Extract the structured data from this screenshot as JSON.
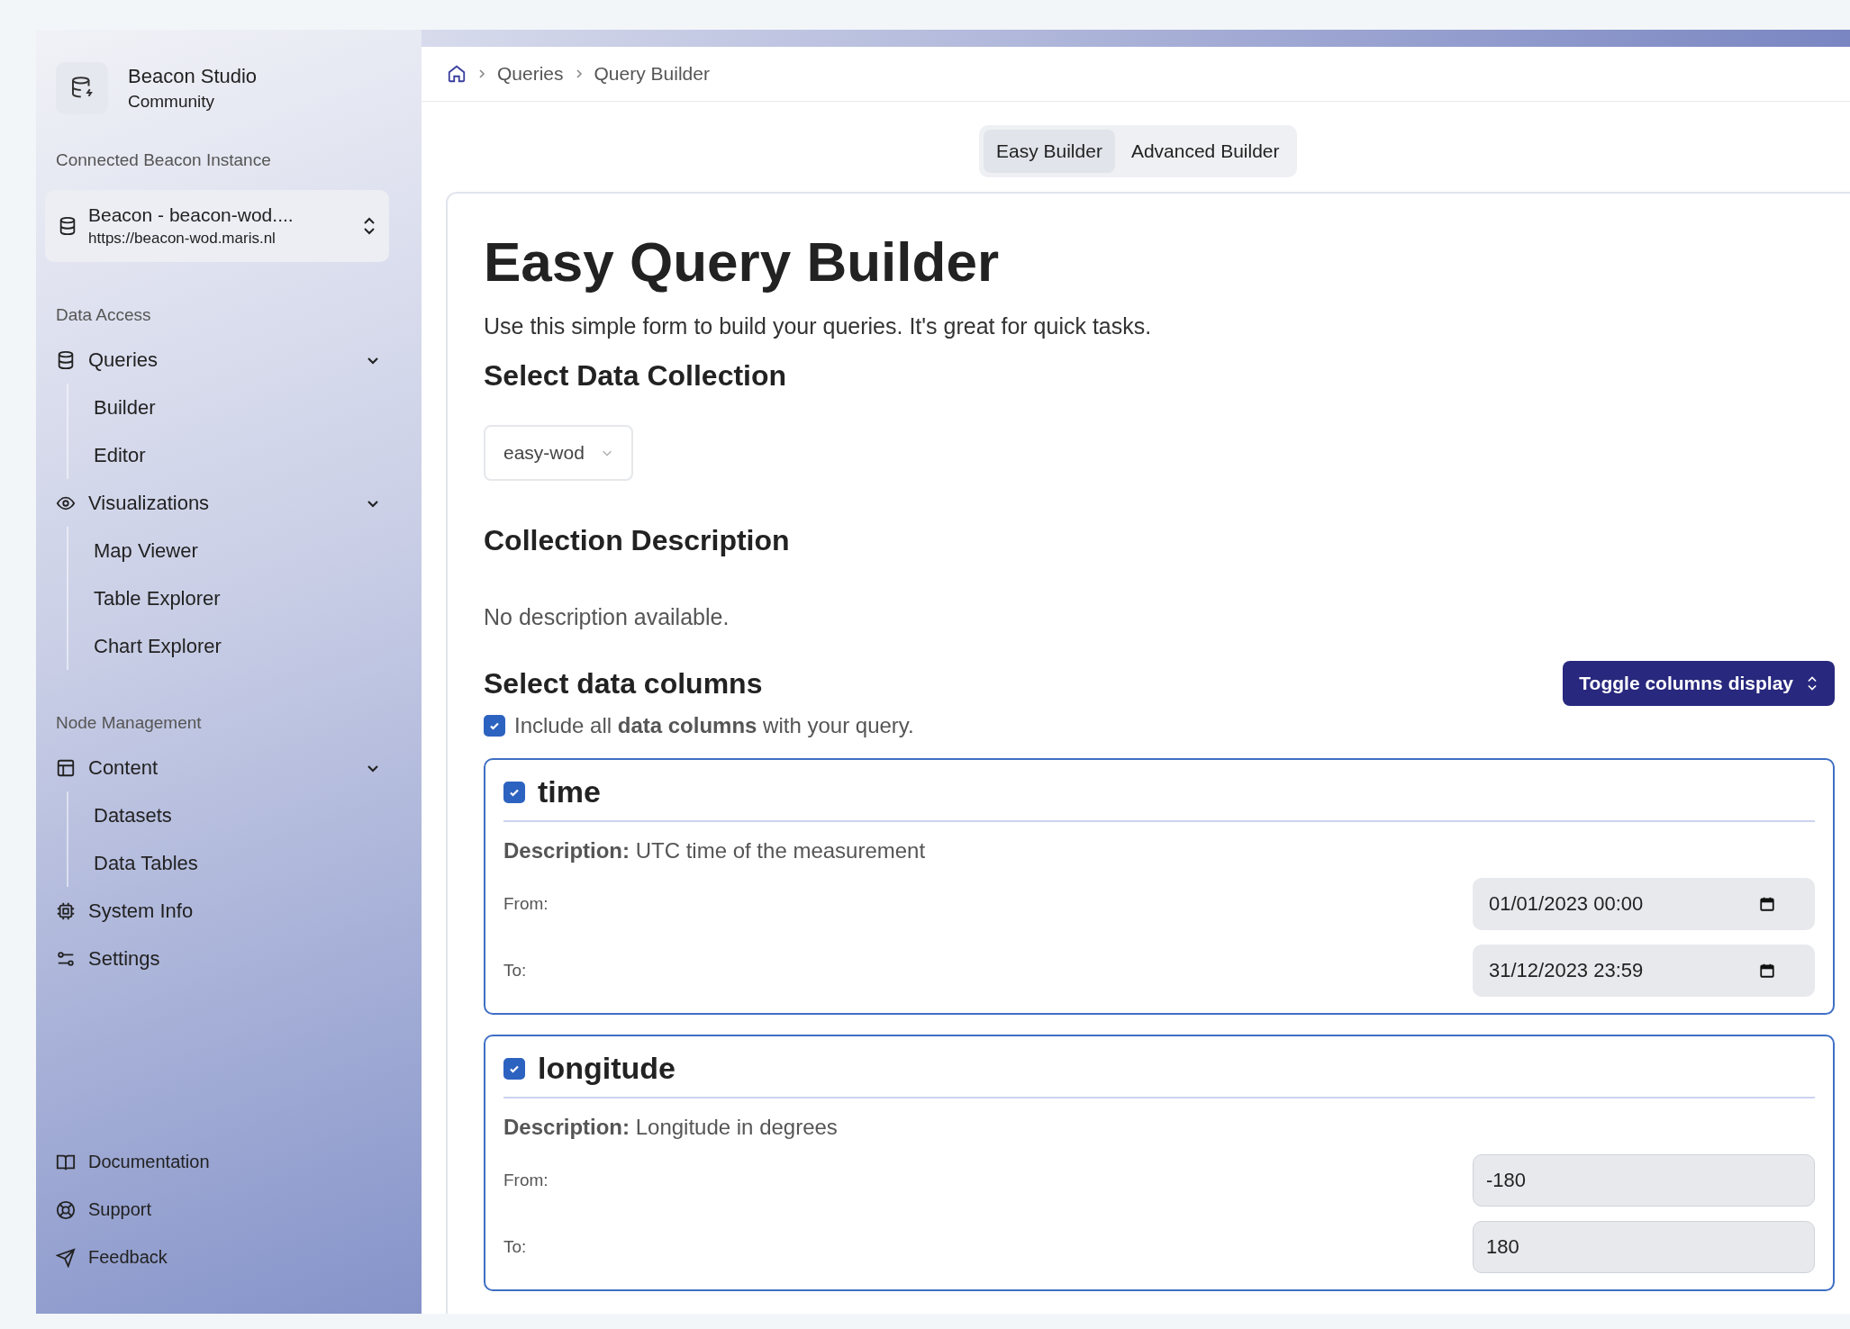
{
  "brand": {
    "name": "Beacon Studio",
    "edition": "Community"
  },
  "instance": {
    "label": "Connected Beacon Instance",
    "name": "Beacon - beacon-wod....",
    "url": "https://beacon-wod.maris.nl"
  },
  "nav_sections": [
    {
      "title": "Data Access",
      "items": [
        {
          "label": "Queries",
          "expanded": true,
          "children": [
            {
              "label": "Builder"
            },
            {
              "label": "Editor"
            }
          ]
        },
        {
          "label": "Visualizations",
          "expanded": true,
          "children": [
            {
              "label": "Map Viewer"
            },
            {
              "label": "Table Explorer"
            },
            {
              "label": "Chart Explorer"
            }
          ]
        }
      ]
    },
    {
      "title": "Node Management",
      "items": [
        {
          "label": "Content",
          "expanded": true,
          "children": [
            {
              "label": "Datasets"
            },
            {
              "label": "Data Tables"
            }
          ]
        },
        {
          "label": "System Info"
        },
        {
          "label": "Settings"
        }
      ]
    }
  ],
  "footer_links": [
    {
      "label": "Documentation"
    },
    {
      "label": "Support"
    },
    {
      "label": "Feedback"
    }
  ],
  "breadcrumb": [
    "Queries",
    "Query Builder"
  ],
  "tabs": [
    {
      "label": "Easy Builder",
      "selected": true
    },
    {
      "label": "Advanced Builder",
      "selected": false
    }
  ],
  "page": {
    "title": "Easy Query Builder",
    "subtitle": "Use this simple form to build your queries. It's great for quick tasks.",
    "collection_heading": "Select Data Collection",
    "collection": "easy-wod",
    "description_heading": "Collection Description",
    "description": "No description available.",
    "columns_heading": "Select data columns",
    "toggle_button": "Toggle columns display",
    "include_all": {
      "checked": true,
      "text": "Include all **data columns** with your query."
    }
  },
  "columns": [
    {
      "name": "time",
      "checked": true,
      "kind": "datetime",
      "description": "**Description:** UTC time of the measurement",
      "from_label": "From:",
      "from": "01/01/2023 00:00",
      "to_label": "To:",
      "to": "31/12/2023 23:59"
    },
    {
      "name": "longitude",
      "checked": true,
      "kind": "number",
      "description": "**Description:** Longitude in degrees",
      "from_label": "From:",
      "from": "-180",
      "to_label": "To:",
      "to": "180"
    }
  ]
}
